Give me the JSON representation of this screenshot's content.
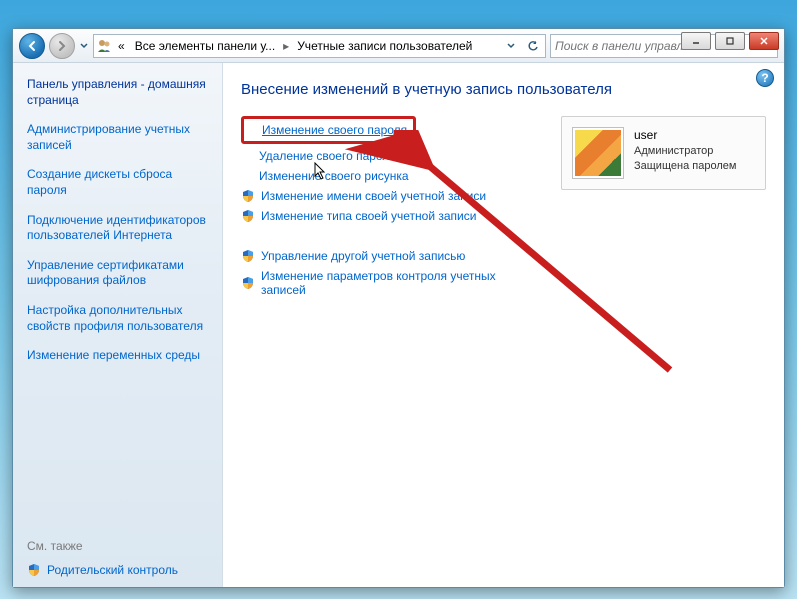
{
  "window_controls": {
    "min": "_",
    "max": "▢",
    "close": "×"
  },
  "nav": {
    "breadcrumb_parent": "Все элементы панели у...",
    "breadcrumb_current": "Учетные записи пользователей",
    "search_placeholder": "Поиск в панели управления"
  },
  "sidebar": {
    "title": "Панель управления - домашняя страница",
    "links": [
      "Администрирование учетных записей",
      "Создание дискеты сброса пароля",
      "Подключение идентификаторов пользователей Интернета",
      "Управление сертификатами шифрования файлов",
      "Настройка дополнительных свойств профиля пользователя",
      "Изменение переменных среды"
    ],
    "see_also_label": "См. также",
    "see_also_link": "Родительский контроль"
  },
  "main": {
    "heading": "Внесение изменений в учетную запись пользователя",
    "actions_plain": [
      "Изменение своего пароля",
      "Удаление своего пароля",
      "Изменение своего рисунка"
    ],
    "actions_shield": [
      "Изменение имени своей учетной записи",
      "Изменение типа своей учетной записи"
    ],
    "actions_group2": [
      "Управление другой учетной записью",
      "Изменение параметров контроля учетных записей"
    ],
    "user": {
      "name": "user",
      "role": "Администратор",
      "status": "Защищена паролем"
    }
  }
}
